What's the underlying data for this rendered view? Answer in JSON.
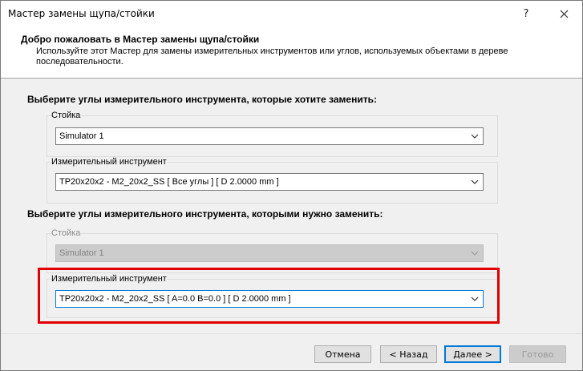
{
  "window": {
    "title": "Мастер замены щупа/стойки",
    "help_label": "?",
    "close_label": "✕"
  },
  "header": {
    "title": "Добро пожаловать в Мастер замены щупа/стойки",
    "description": "Используйте этот Мастер для замены измерительных инструментов или углов, используемых объектами в дереве последовательности."
  },
  "source_section": {
    "title": "Выберите углы измерительного инструмента, которые хотите заменить:",
    "stand": {
      "label": "Стойка",
      "value": "Simulator 1"
    },
    "tool": {
      "label": "Измерительный инструмент",
      "value": "TP20x20x2 - M2_20x2_SS [ Все углы ] [ D 2.0000 mm ]"
    }
  },
  "target_section": {
    "title": "Выберите углы измерительного инструмента, которыми нужно заменить:",
    "stand": {
      "label": "Стойка",
      "value": "Simulator 1"
    },
    "tool": {
      "label": "Измерительный инструмент",
      "value": "TP20x20x2 - M2_20x2_SS [ A=0.0 B=0.0 ] [ D 2.0000 mm ]"
    }
  },
  "buttons": {
    "cancel": "Отмена",
    "back": "< Назад",
    "next": "Далее >",
    "finish": "Готово"
  },
  "colors": {
    "highlight": "#e00000",
    "accent": "#0078d7"
  }
}
